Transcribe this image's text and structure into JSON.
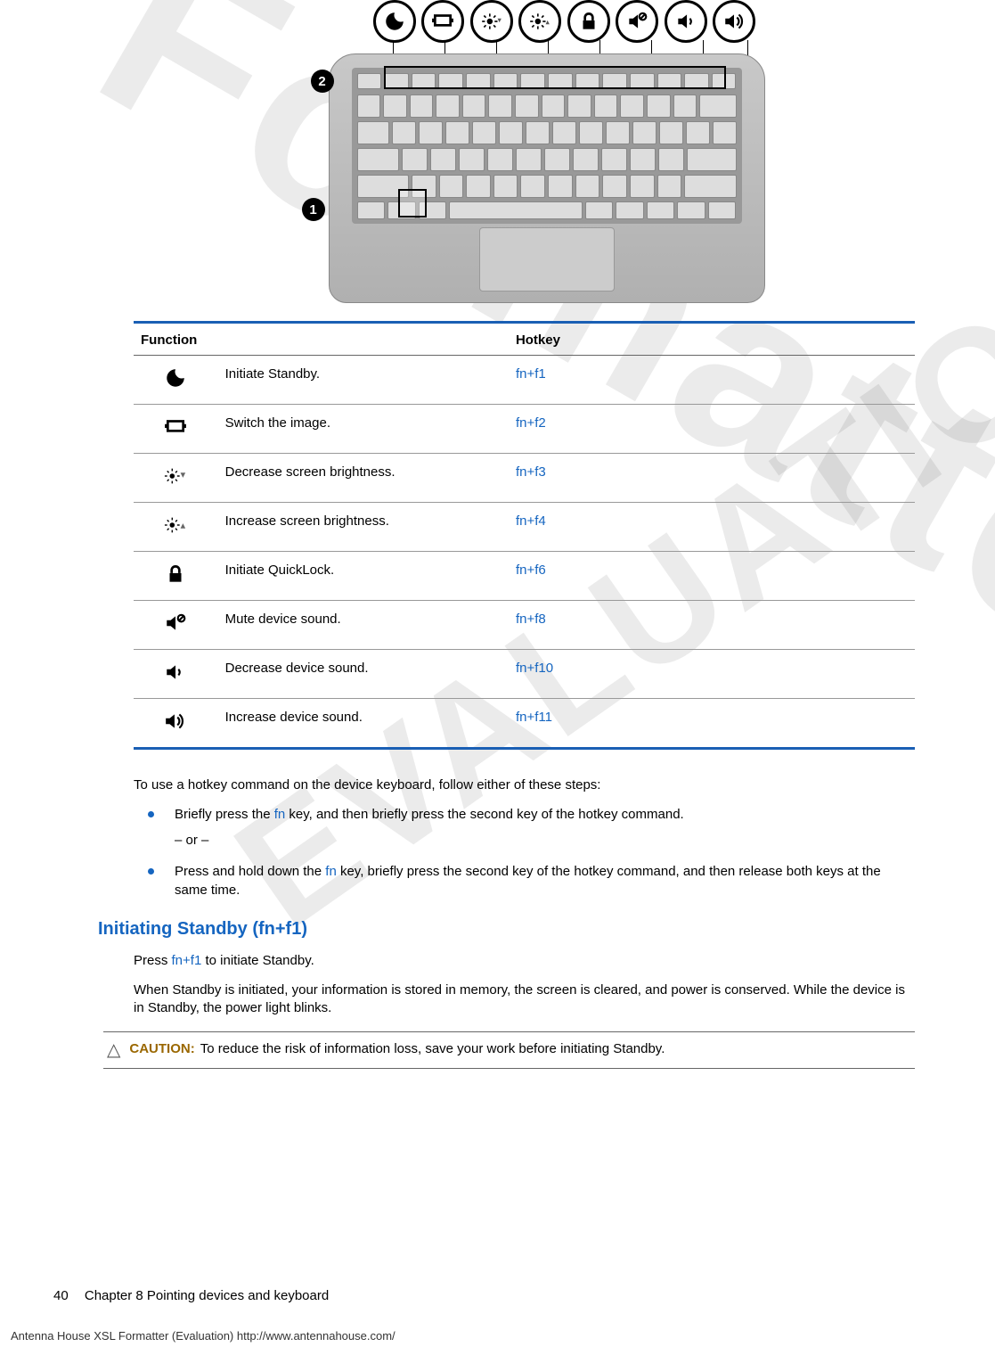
{
  "watermarks": {
    "big": "Formatter",
    "small": "EVALUATION"
  },
  "figure": {
    "callouts": {
      "c1": "1",
      "c2": "2"
    },
    "bubbles": [
      "moon",
      "display",
      "bright-down",
      "bright-up",
      "lock",
      "mute",
      "vol-down",
      "vol-up"
    ]
  },
  "table": {
    "headers": {
      "function": "Function",
      "hotkey": "Hotkey"
    },
    "rows": [
      {
        "icon": "moon",
        "func": "Initiate Standby.",
        "hotkey": "fn+f1"
      },
      {
        "icon": "display",
        "func": "Switch the image.",
        "hotkey": "fn+f2"
      },
      {
        "icon": "bright-down",
        "func": "Decrease screen brightness.",
        "hotkey": "fn+f3"
      },
      {
        "icon": "bright-up",
        "func": "Increase screen brightness.",
        "hotkey": "fn+f4"
      },
      {
        "icon": "lock",
        "func": "Initiate QuickLock.",
        "hotkey": "fn+f6"
      },
      {
        "icon": "mute",
        "func": "Mute device sound.",
        "hotkey": "fn+f8"
      },
      {
        "icon": "vol-down",
        "func": "Decrease device sound.",
        "hotkey": "fn+f10"
      },
      {
        "icon": "vol-up",
        "func": "Increase device sound.",
        "hotkey": "fn+f11"
      }
    ]
  },
  "body": {
    "intro": "To use a hotkey command on the device keyboard, follow either of these steps:",
    "step1_a": "Briefly press the ",
    "step1_fn": "fn",
    "step1_b": " key, and then briefly press the second key of the hotkey command.",
    "or": "– or –",
    "step2_a": "Press and hold down the ",
    "step2_fn": "fn",
    "step2_b": " key, briefly press the second key of the hotkey command, and then release both keys at the same time."
  },
  "section": {
    "heading": "Initiating Standby (fn+f1)",
    "p1_a": "Press ",
    "p1_link": "fn+f1",
    "p1_b": " to initiate Standby.",
    "p2": "When Standby is initiated, your information is stored in memory, the screen is cleared, and power is conserved. While the device is in Standby, the power light blinks."
  },
  "caution": {
    "label": "CAUTION:",
    "text": "To reduce the risk of information loss, save your work before initiating Standby."
  },
  "footer": {
    "page": "40",
    "chapter": "Chapter 8   Pointing devices and keyboard"
  },
  "eval": "Antenna House XSL Formatter (Evaluation)  http://www.antennahouse.com/"
}
